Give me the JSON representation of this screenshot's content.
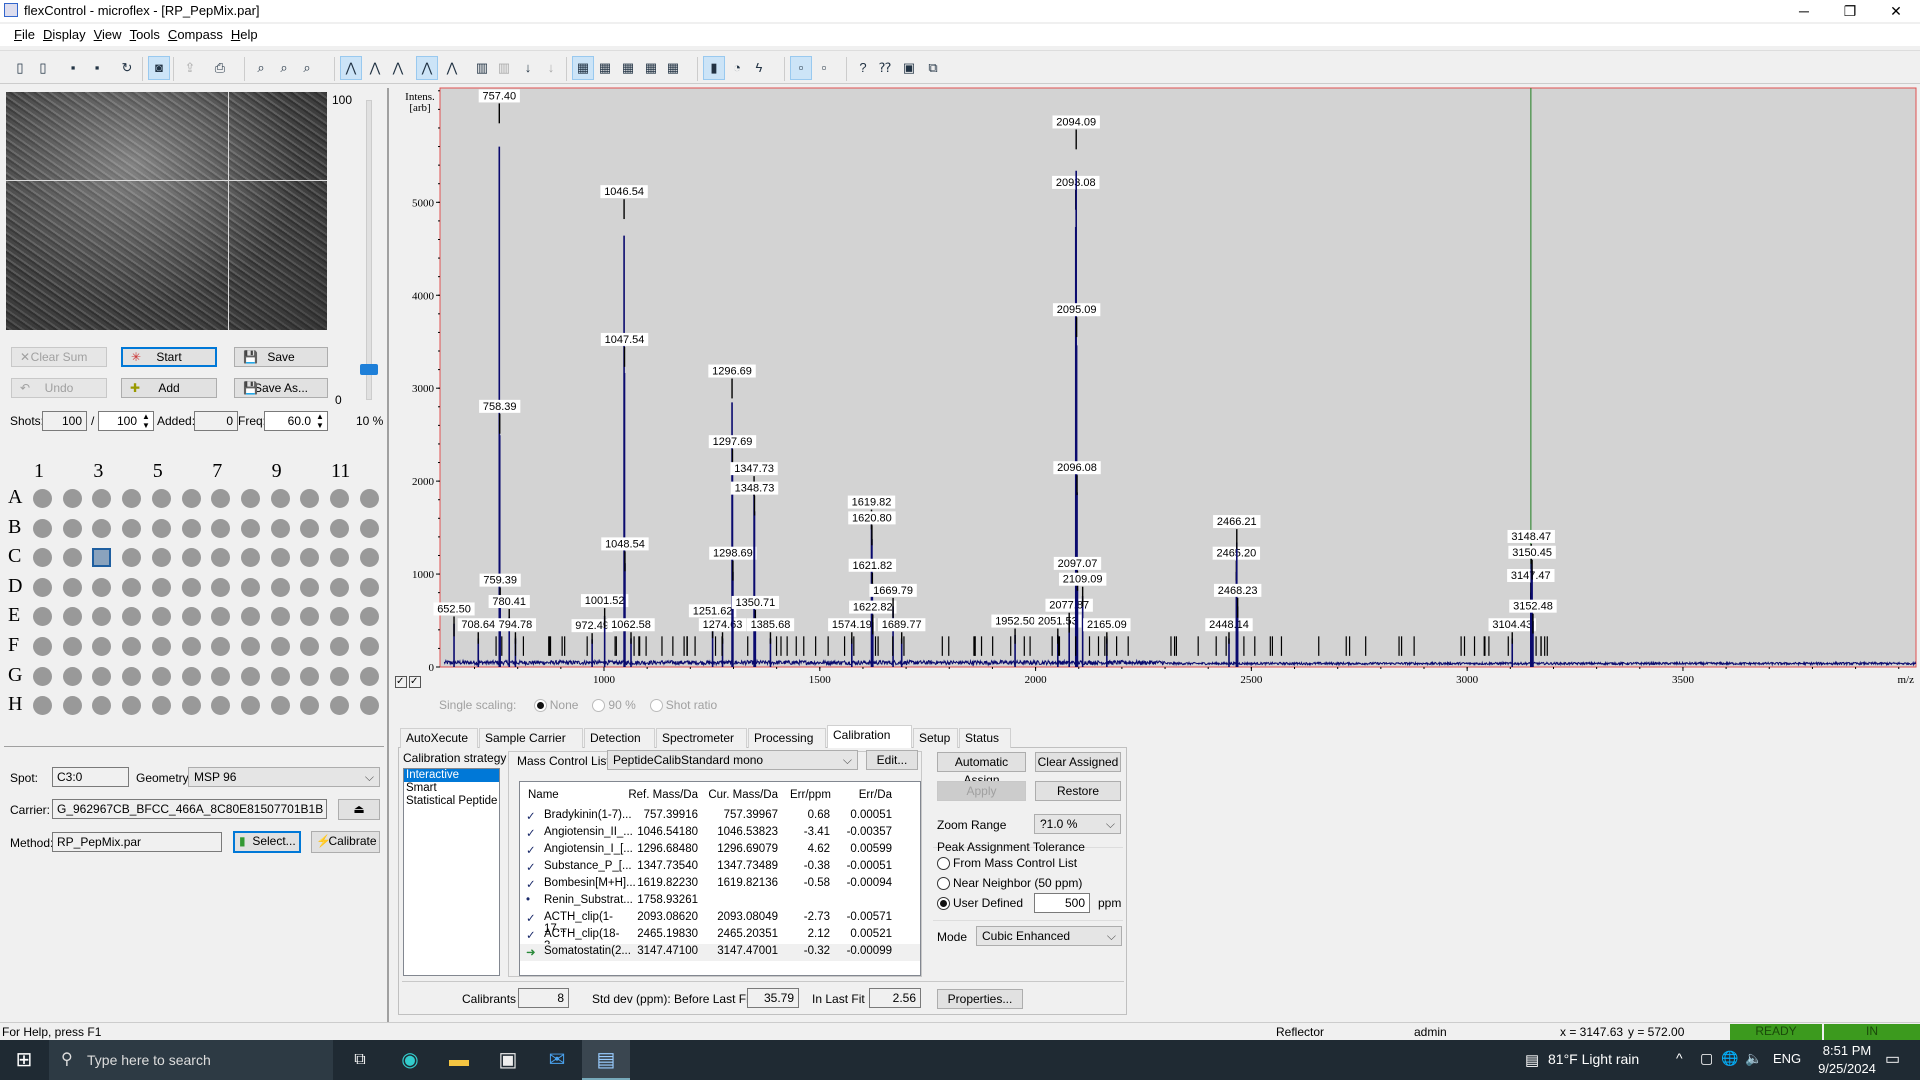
{
  "window": {
    "title": "flexControl - microflex - [RP_PepMix.par]",
    "minimize": "─",
    "restore": "❐",
    "close": "✕"
  },
  "menu": [
    "File",
    "Display",
    "View",
    "Tools",
    "Compass",
    "Help"
  ],
  "toolbar": {
    "icons": [
      [
        "open-method-icon",
        16,
        ""
      ],
      [
        "open-file-icon",
        35,
        ""
      ],
      [
        "save-icon",
        60,
        ""
      ],
      [
        "save-as-icon",
        79,
        ""
      ],
      [
        "refresh-icon",
        104,
        ""
      ],
      [
        "camera-icon",
        130,
        "on"
      ],
      [
        "export-icon",
        155,
        "dis"
      ],
      [
        "print-icon",
        180,
        ""
      ],
      [
        "zoom-in-icon",
        213,
        ""
      ],
      [
        "zoom-x-icon",
        232,
        ""
      ],
      [
        "zoom-out-icon",
        251,
        ""
      ],
      [
        "peak-pick-icon",
        287,
        "on"
      ],
      [
        "peak-icon",
        306,
        ""
      ],
      [
        "peak-down-icon",
        325,
        ""
      ],
      [
        "peak-label-icon",
        349,
        "on"
      ],
      [
        "peak-info-icon",
        369,
        ""
      ],
      [
        "bar-spectrum-icon",
        394,
        ""
      ],
      [
        "bar-spectrum-2-icon",
        412,
        "dis"
      ],
      [
        "arrow-down-icon",
        431,
        ""
      ],
      [
        "arrow-down-2-icon",
        450,
        "dis"
      ],
      [
        "layout-1-icon",
        476,
        "on"
      ],
      [
        "layout-2-icon",
        494,
        ""
      ],
      [
        "layout-3-icon",
        513,
        ""
      ],
      [
        "layout-4-icon",
        532,
        ""
      ],
      [
        "layout-5-icon",
        550,
        ""
      ],
      [
        "laser-icon",
        583,
        "on"
      ],
      [
        "timer-icon",
        602,
        ""
      ],
      [
        "flash-icon",
        620,
        ""
      ],
      [
        "panel-left-icon",
        654,
        "on"
      ],
      [
        "panel-right-icon",
        673,
        ""
      ],
      [
        "help-icon",
        705,
        ""
      ],
      [
        "context-help-icon",
        723,
        ""
      ],
      [
        "monitor-icon",
        742,
        ""
      ],
      [
        "window-icon",
        762,
        ""
      ]
    ]
  },
  "acquisition": {
    "buttons": {
      "clear_sum": "Clear Sum",
      "start": "Start",
      "save": "Save",
      "undo": "Undo",
      "add": "Add",
      "save_as": "Save As..."
    },
    "slider": {
      "max_label": "100",
      "min_label": "0",
      "value_label": "10 %",
      "value_percent": 10
    },
    "shots_label": "Shots:",
    "shots": "100",
    "separator": "/",
    "shots_total": "100",
    "added_label": "Added:",
    "added": "0",
    "freq_label": "Freq:",
    "freq": "60.0"
  },
  "plate": {
    "column_labels": [
      "1",
      "3",
      "5",
      "7",
      "9",
      "11"
    ],
    "rows": [
      "A",
      "B",
      "C",
      "D",
      "E",
      "F",
      "G",
      "H"
    ],
    "columns": 12,
    "selected": "C3"
  },
  "sample": {
    "spot_label": "Spot:",
    "spot": "C3:0",
    "geometry_label": "Geometry:",
    "geometry": "MSP 96",
    "carrier_label": "Carrier:",
    "carrier": "G_962967CB_BFCC_466A_8C80E81507701B1B",
    "method_label": "Method:",
    "method": "RP_PepMix.par",
    "select": "Select...",
    "calibrate": "Calibrate",
    "eject": "⏏"
  },
  "chart_data": {
    "type": "line",
    "title": "",
    "xlabel": "m/z",
    "ylabel": "Intens. [arb]",
    "xlim": [
      620,
      4040
    ],
    "ylim": [
      0,
      6230
    ],
    "xticks": [
      1000,
      1500,
      2000,
      2500,
      3000,
      3500
    ],
    "yticks": [
      0,
      1000,
      2000,
      3000,
      4000,
      5000
    ],
    "cursor_line_mz": 3147.6,
    "colors": {
      "trace": "#0a0a6e",
      "cursor": "#3c8c3c",
      "background": "#d3d3d3",
      "frame": "#e05050"
    },
    "peaks": [
      [
        "652.50",
        652.5,
        630
      ],
      [
        "708.64",
        708.64,
        460
      ],
      [
        "757.40",
        757.4,
        6150
      ],
      [
        "758.39",
        758.39,
        2810
      ],
      [
        "759.39",
        759.39,
        940
      ],
      [
        "780.41",
        780.41,
        710
      ],
      [
        "794.78",
        794.78,
        460
      ],
      [
        "972.49",
        972.49,
        450
      ],
      [
        "1001.52",
        1001.52,
        720
      ],
      [
        "1046.54",
        1046.54,
        5120
      ],
      [
        "1047.54",
        1047.54,
        3530
      ],
      [
        "1048.54",
        1048.54,
        1330
      ],
      [
        "1062.58",
        1062.58,
        460
      ],
      [
        "1251.62",
        1251.62,
        610
      ],
      [
        "1274.63",
        1274.63,
        460
      ],
      [
        "1296.69",
        1296.69,
        3190
      ],
      [
        "1297.69",
        1297.69,
        2430
      ],
      [
        "1298.69",
        1298.69,
        1230
      ],
      [
        "1347.73",
        1347.73,
        2140
      ],
      [
        "1348.73",
        1348.73,
        1930
      ],
      [
        "1350.71",
        1350.71,
        700
      ],
      [
        "1385.68",
        1385.68,
        460
      ],
      [
        "1574.19",
        1574.19,
        460
      ],
      [
        "1619.82",
        1619.82,
        1780
      ],
      [
        "1620.80",
        1620.8,
        1610
      ],
      [
        "1621.82",
        1621.82,
        1100
      ],
      [
        "1622.82",
        1622.82,
        650
      ],
      [
        "1669.79",
        1669.79,
        830
      ],
      [
        "1689.77",
        1689.77,
        460
      ],
      [
        "1952.50",
        1952.5,
        500
      ],
      [
        "2051.53",
        2051.53,
        500
      ],
      [
        "2077.87",
        2077.87,
        670
      ],
      [
        "2093.08",
        2093.08,
        5220
      ],
      [
        "2094.09",
        2094.09,
        5870
      ],
      [
        "2095.09",
        2095.09,
        3850
      ],
      [
        "2096.08",
        2096.08,
        2150
      ],
      [
        "2097.07",
        2097.07,
        1120
      ],
      [
        "2109.09",
        2109.09,
        950
      ],
      [
        "2165.09",
        2165.09,
        460
      ],
      [
        "2448.14",
        2448.14,
        460
      ],
      [
        "2465.20",
        2465.2,
        1230
      ],
      [
        "2466.21",
        2466.21,
        1570
      ],
      [
        "2468.23",
        2468.23,
        830
      ],
      [
        "3104.43",
        3104.43,
        460
      ],
      [
        "3147.47",
        3147.47,
        990
      ],
      [
        "3148.47",
        3148.47,
        1410
      ],
      [
        "3150.45",
        3150.45,
        1240
      ],
      [
        "3152.48",
        3152.48,
        660
      ]
    ]
  },
  "scaling": {
    "label": "Single scaling:",
    "options": [
      "None",
      "90 %",
      "Shot ratio"
    ],
    "selected": "None"
  },
  "tabs": [
    "AutoXecute",
    "Sample Carrier",
    "Detection",
    "Spectrometer",
    "Processing",
    "Calibration",
    "Setup",
    "Status"
  ],
  "active_tab": "Calibration",
  "calibration": {
    "strategy_label": "Calibration strategy",
    "strategies": [
      "Interactive",
      "Smart",
      "Statistical Peptide"
    ],
    "strategy_selected": "Interactive",
    "mcl_label": "Mass Control List",
    "mcl": "PeptideCalibStandard mono",
    "edit": "Edit...",
    "columns": [
      "Name",
      "Ref. Mass/Da",
      "Cur. Mass/Da",
      "Err/ppm",
      "Err/Da"
    ],
    "rows": [
      {
        "status": "assigned",
        "name": "Bradykinin(1-7)...",
        "ref": "757.39916",
        "cur": "757.39967",
        "ppm": "0.68",
        "da": "0.00051"
      },
      {
        "status": "assigned",
        "name": "Angiotensin_II_...",
        "ref": "1046.54180",
        "cur": "1046.53823",
        "ppm": "-3.41",
        "da": "-0.00357"
      },
      {
        "status": "assigned",
        "name": "Angiotensin_I_[...",
        "ref": "1296.68480",
        "cur": "1296.69079",
        "ppm": "4.62",
        "da": "0.00599"
      },
      {
        "status": "assigned",
        "name": "Substance_P_[...",
        "ref": "1347.73540",
        "cur": "1347.73489",
        "ppm": "-0.38",
        "da": "-0.00051"
      },
      {
        "status": "assigned",
        "name": "Bombesin[M+H]...",
        "ref": "1619.82230",
        "cur": "1619.82136",
        "ppm": "-0.58",
        "da": "-0.00094"
      },
      {
        "status": "unassigned",
        "name": "Renin_Substrat...",
        "ref": "1758.93261",
        "cur": "",
        "ppm": "",
        "da": ""
      },
      {
        "status": "assigned",
        "name": "ACTH_clip(1-17...",
        "ref": "2093.08620",
        "cur": "2093.08049",
        "ppm": "-2.73",
        "da": "-0.00571"
      },
      {
        "status": "assigned",
        "name": "ACTH_clip(18-3...",
        "ref": "2465.19830",
        "cur": "2465.20351",
        "ppm": "2.12",
        "da": "0.00521"
      },
      {
        "status": "current",
        "name": "Somatostatin(2...",
        "ref": "3147.47100",
        "cur": "3147.47001",
        "ppm": "-0.32",
        "da": "-0.00099"
      }
    ],
    "automatic_assign": "Automatic Assign",
    "clear_assigned": "Clear Assigned",
    "apply": "Apply",
    "restore": "Restore",
    "zoom_label": "Zoom Range",
    "zoom": "?1.0 %",
    "tolerance_label": "Peak Assignment Tolerance",
    "tolerance_options": [
      "From Mass Control List",
      "Near Neighbor (50 ppm)",
      "User Defined"
    ],
    "tolerance_selected": "User Defined",
    "tolerance_value": "500",
    "tolerance_unit": "ppm",
    "mode_label": "Mode",
    "mode": "Cubic Enhanced",
    "calibrants_label": "Calibrants",
    "calibrants": "8",
    "stddev_label": "Std dev (ppm): Before Last Fit",
    "stddev_before": "35.79",
    "last_fit_label": "In Last Fit",
    "stddev_last": "2.56",
    "properties": "Properties..."
  },
  "statusbar": {
    "help": "For Help, press F1",
    "mode": "Reflector",
    "user": "admin",
    "x": "x = 3147.63",
    "y": "y = 572.00",
    "ready": "READY",
    "in": "IN",
    "ready_color": "#3c9a1e"
  },
  "taskbar": {
    "search_placeholder": "Type here to search",
    "weather": "81°F  Light rain",
    "lang": "ENG",
    "time": "8:51 PM",
    "date": "9/25/2024"
  }
}
